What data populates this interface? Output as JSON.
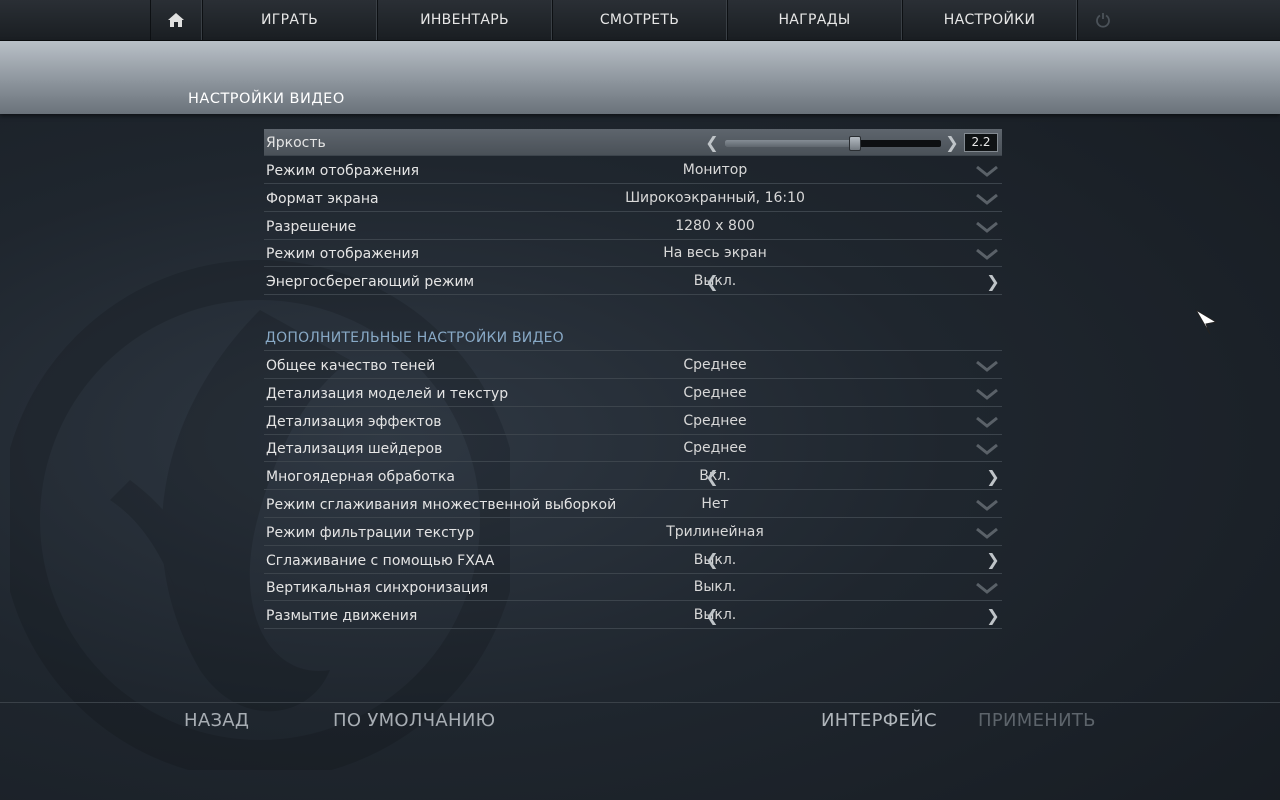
{
  "nav": {
    "home_icon": "home-icon",
    "items": [
      "ИГРАТЬ",
      "ИНВЕНТАРЬ",
      "СМОТРЕТЬ",
      "НАГРАДЫ",
      "НАСТРОЙКИ"
    ],
    "power_icon": "power-icon"
  },
  "page": {
    "title": "НАСТРОЙКИ ВИДЕО"
  },
  "brightness": {
    "label": "Яркость",
    "value": "2.2",
    "level": 0.6
  },
  "video": [
    {
      "label": "Режим отображения",
      "value": "Монитор",
      "control": "dropdown"
    },
    {
      "label": "Формат экрана",
      "value": "Широкоэкранный, 16:10",
      "control": "dropdown"
    },
    {
      "label": "Разрешение",
      "value": "1280 x 800",
      "control": "dropdown"
    },
    {
      "label": "Режим отображения",
      "value": "На весь экран",
      "control": "dropdown"
    },
    {
      "label": "Энергосберегающий режим",
      "value": "Выкл.",
      "control": "toggle"
    }
  ],
  "advanced": {
    "title": "ДОПОЛНИТЕЛЬНЫЕ НАСТРОЙКИ ВИДЕО",
    "items": [
      {
        "label": "Общее качество теней",
        "value": "Среднее",
        "control": "dropdown"
      },
      {
        "label": "Детализация моделей и текстур",
        "value": "Среднее",
        "control": "dropdown"
      },
      {
        "label": "Детализация эффектов",
        "value": "Среднее",
        "control": "dropdown"
      },
      {
        "label": "Детализация шейдеров",
        "value": "Среднее",
        "control": "dropdown"
      },
      {
        "label": "Многоядерная обработка",
        "value": "Вкл.",
        "control": "toggle"
      },
      {
        "label": "Режим сглаживания множественной выборкой",
        "value": "Нет",
        "control": "dropdown"
      },
      {
        "label": "Режим фильтрации текстур",
        "value": "Трилинейная",
        "control": "dropdown"
      },
      {
        "label": "Сглаживание с помощью FXAA",
        "value": "Выкл.",
        "control": "toggle"
      },
      {
        "label": "Вертикальная синхронизация",
        "value": "Выкл.",
        "control": "dropdown"
      },
      {
        "label": "Размытие движения",
        "value": "Выкл.",
        "control": "toggle"
      }
    ]
  },
  "footer": {
    "back": "НАЗАД",
    "defaults": "ПО УМОЛЧАНИЮ",
    "interface": "ИНТЕРФЕЙС",
    "apply": "ПРИМЕНИТЬ"
  },
  "colors": {
    "section_title": "#88a9c6",
    "apply_disabled": "#5d646b"
  }
}
